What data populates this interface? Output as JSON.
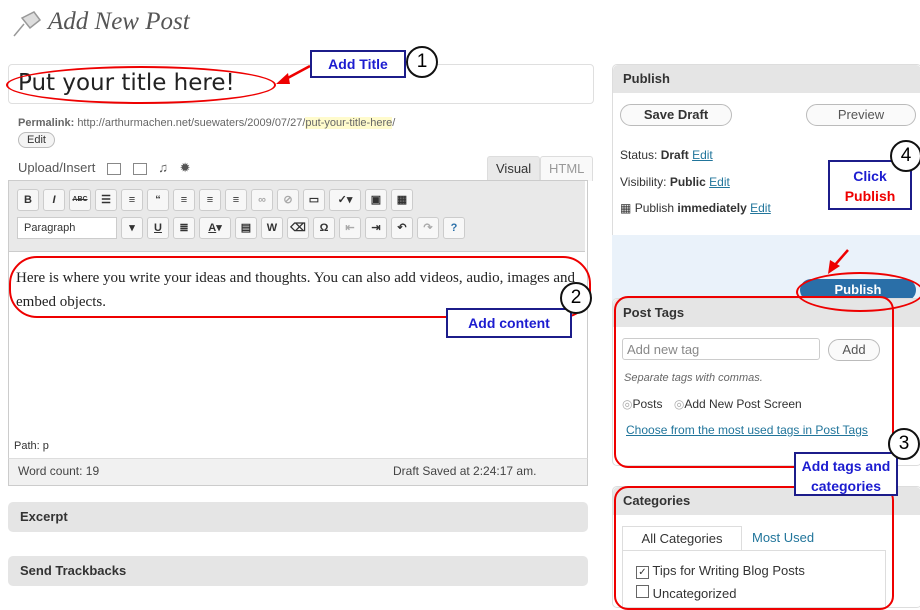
{
  "header": {
    "title": "Add New Post"
  },
  "post": {
    "title_value": "Put your title here!",
    "permalink_label": "Permalink:",
    "permalink_base": "http://arthurmachen.net/suewaters/2009/07/27/",
    "permalink_slug": "put-your-title-here",
    "permalink_end": "/",
    "edit_label": "Edit"
  },
  "editor": {
    "upload_label": "Upload/Insert",
    "tab_visual": "Visual",
    "tab_html": "HTML",
    "format_select": "Paragraph",
    "content": "Here is where  you write your ideas and thoughts.  You can also add videos, audio, images and embed objects.",
    "path": "Path: p",
    "word_count": "Word count: 19",
    "draft_saved": "Draft Saved at 2:24:17 am."
  },
  "panels": {
    "excerpt": "Excerpt",
    "trackbacks": "Send Trackbacks"
  },
  "publish": {
    "heading": "Publish",
    "save_draft": "Save Draft",
    "preview": "Preview",
    "status_label": "Status:",
    "status_value": "Draft",
    "visibility_label": "Visibility:",
    "visibility_value": "Public",
    "publish_label": "Publish",
    "publish_when": "immediately",
    "edit": "Edit",
    "publish_button": "Publish"
  },
  "tags": {
    "heading": "Post Tags",
    "placeholder": "Add new tag",
    "add": "Add",
    "hint": "Separate tags with commas.",
    "opt1": "Posts",
    "opt2": "Add New Post Screen",
    "choose": "Choose from the most used tags in Post Tags"
  },
  "categories": {
    "heading": "Categories",
    "tab_all": "All Categories",
    "tab_used": "Most Used",
    "items": [
      {
        "label": "Tips for Writing Blog Posts",
        "checked": true
      },
      {
        "label": "Uncategorized",
        "checked": false
      }
    ]
  },
  "annotations": {
    "add_title": "Add Title",
    "add_content": "Add content",
    "click": "Click",
    "publish": "Publish",
    "add_tags_1": "Add tags and",
    "add_tags_2": "categories",
    "n1": "1",
    "n2": "2",
    "n3": "3",
    "n4": "4"
  },
  "colors": {
    "annotation_red": "#e00000",
    "annotation_blue": "#1c1c8a",
    "publish_blue": "#2a6fa8",
    "link": "#21759b"
  }
}
